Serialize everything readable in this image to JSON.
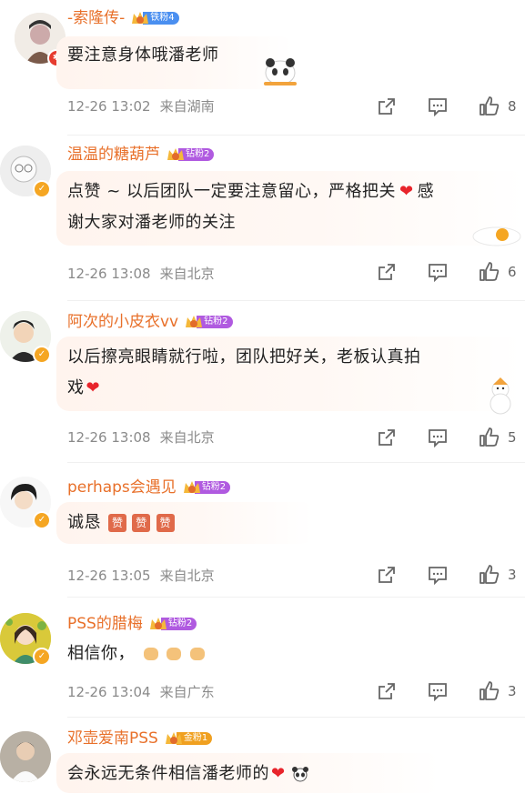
{
  "comments": [
    {
      "username": "-索隆传-",
      "badge": "铁粉4",
      "badge_color": "#4a8ff0",
      "text": "要注意身体哦潘老师",
      "time": "12-26 13:02",
      "location": "来自湖南",
      "likes": "8"
    },
    {
      "username": "温温的糖葫芦",
      "badge": "钻粉2",
      "badge_color": "#b05ae0",
      "text_line1": "点赞 ~ 以后团队一定要注意留心，严格把关",
      "text_line1b": "感",
      "text_line2": "谢大家对潘老师的关注",
      "time": "12-26 13:08",
      "location": "来自北京",
      "likes": "6"
    },
    {
      "username": "阿次的小皮衣vv",
      "badge": "钻粉2",
      "badge_color": "#b05ae0",
      "text_line1": "以后擦亮眼睛就行啦，团队把好关，老板认真拍",
      "text_line2": "戏",
      "time": "12-26 13:08",
      "location": "来自北京",
      "likes": "5"
    },
    {
      "username": "perhaps会遇见",
      "badge": "钻粉2",
      "badge_color": "#b05ae0",
      "text": "诚恳",
      "time": "12-26 13:05",
      "location": "来自北京",
      "likes": "3"
    },
    {
      "username": "PSS的腊梅",
      "badge": "钻粉2",
      "badge_color": "#b05ae0",
      "text": "相信你，",
      "time": "12-26 13:04",
      "location": "来自广东",
      "likes": "3"
    },
    {
      "username": "邓壶爱南PSS",
      "badge": "金粉1",
      "badge_color": "#f0a020",
      "text": "会永远无条件相信潘老师的"
    }
  ],
  "colors": {
    "username": "#e8702a",
    "meta": "#8a8a8a",
    "heart": "#e8242b",
    "verified": "#f5a623",
    "red_badge": "#e63b2e"
  },
  "icons": [
    "share-icon",
    "comment-icon",
    "like-icon",
    "heart-emoji",
    "thumbs-up-emoji",
    "fist-emoji",
    "panda-emoji"
  ]
}
